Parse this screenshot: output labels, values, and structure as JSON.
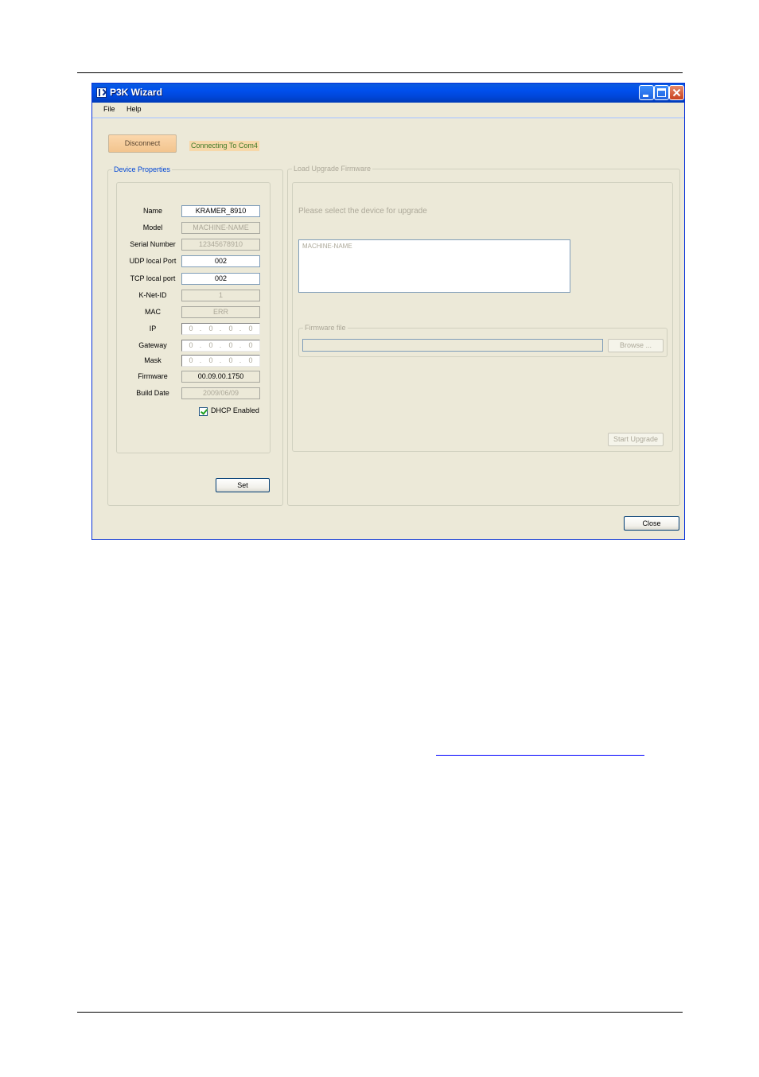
{
  "window": {
    "title": "P3K Wizard",
    "buttons": [
      "minimize",
      "maximize",
      "close"
    ]
  },
  "menu": {
    "file": "File",
    "help": "Help"
  },
  "connection": {
    "disconnect_label": "Disconnect",
    "status_text": "Connecting To Com4"
  },
  "device_properties": {
    "legend": "Device Properties",
    "fields": {
      "name": {
        "label": "Name",
        "value": "KRAMER_8910"
      },
      "model": {
        "label": "Model",
        "value": "MACHINE-NAME"
      },
      "serial": {
        "label": "Serial Number",
        "value": "12345678910"
      },
      "udp": {
        "label": "UDP local Port",
        "value": "002"
      },
      "tcp": {
        "label": "TCP local port",
        "value": "002"
      },
      "knet": {
        "label": "K-Net-ID",
        "value": "1"
      },
      "mac": {
        "label": "MAC",
        "value": "ERR"
      },
      "ip": {
        "label": "IP",
        "octets": [
          "0",
          "0",
          "0",
          "0"
        ]
      },
      "gateway": {
        "label": "Gateway",
        "octets": [
          "0",
          "0",
          "0",
          "0"
        ]
      },
      "mask": {
        "label": "Mask",
        "octets": [
          "0",
          "0",
          "0",
          "0"
        ]
      },
      "firmware": {
        "label": "Firmware",
        "value": "00.09.00.1750"
      },
      "build_date": {
        "label": "Build Date",
        "value": "2009/06/09"
      }
    },
    "dhcp_label": "DHCP Enabled",
    "dhcp_checked": true,
    "set_label": "Set"
  },
  "upgrade": {
    "legend": "Load Upgrade Firmware",
    "prompt": "Please select the device for upgrade",
    "devices": [
      "MACHINE-NAME"
    ],
    "firmware_file_legend": "Firmware file",
    "firmware_file_value": "",
    "browse_label": "Browse ...",
    "start_label": "Start Upgrade"
  },
  "close_label": "Close",
  "colors": {
    "title_bar": "#0054e3",
    "window_bg": "#ece9d8",
    "group_legend": "#0046d5",
    "status_bg": "#f7d8a9",
    "status_text": "#3f7a28",
    "disconnect_bg": "#f7cc98"
  }
}
